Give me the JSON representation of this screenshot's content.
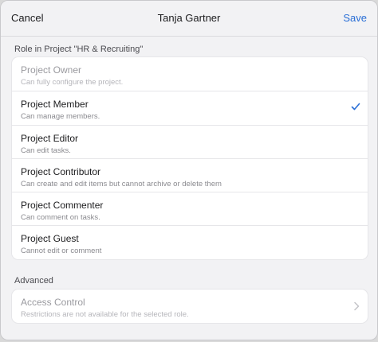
{
  "header": {
    "cancel_label": "Cancel",
    "title": "Tanja Gartner",
    "save_label": "Save"
  },
  "role_section": {
    "label": "Role in Project \"HR & Recruiting\"",
    "roles": [
      {
        "title": "Project Owner",
        "subtitle": "Can fully configure the project.",
        "disabled": true,
        "selected": false
      },
      {
        "title": "Project Member",
        "subtitle": "Can manage members.",
        "disabled": false,
        "selected": true
      },
      {
        "title": "Project Editor",
        "subtitle": "Can edit tasks.",
        "disabled": false,
        "selected": false
      },
      {
        "title": "Project Contributor",
        "subtitle": "Can create and edit items but cannot archive or delete them",
        "disabled": false,
        "selected": false
      },
      {
        "title": "Project Commenter",
        "subtitle": "Can comment on tasks.",
        "disabled": false,
        "selected": false
      },
      {
        "title": "Project Guest",
        "subtitle": "Cannot edit or comment",
        "disabled": false,
        "selected": false
      }
    ]
  },
  "advanced_section": {
    "label": "Advanced",
    "access_control": {
      "title": "Access Control",
      "subtitle": "Restrictions are not available for the selected role.",
      "disabled": true
    }
  },
  "colors": {
    "accent": "#2a6fd6",
    "background": "#f2f2f4",
    "card": "#ffffff"
  },
  "icons": {
    "selected_indicator": "checkmark-icon",
    "disclosure": "chevron-right-icon"
  }
}
